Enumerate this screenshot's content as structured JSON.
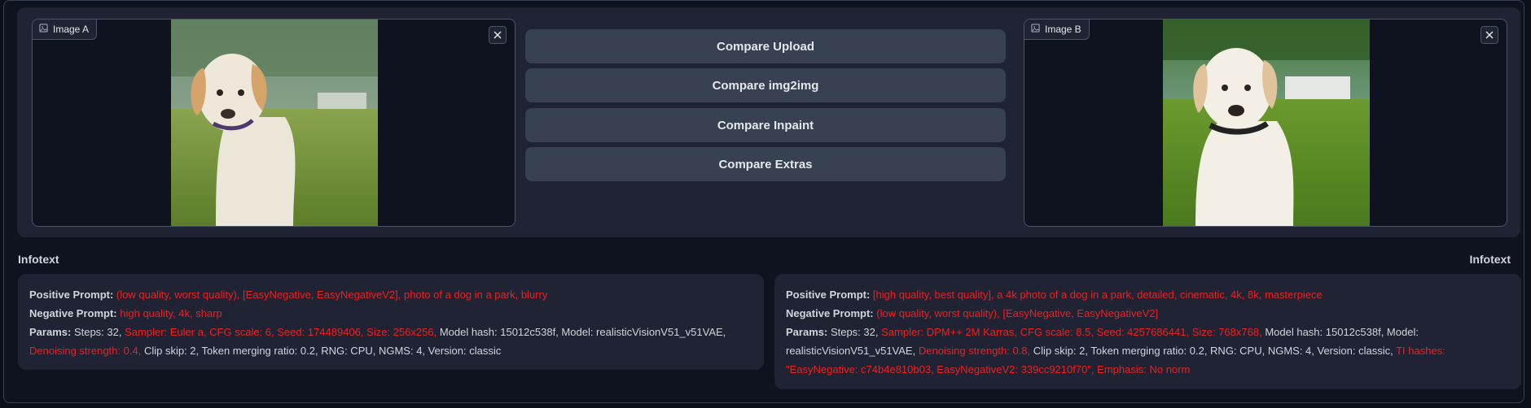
{
  "image_a": {
    "label": "Image A",
    "icon": "image-icon"
  },
  "image_b": {
    "label": "Image B",
    "icon": "image-icon"
  },
  "buttons": {
    "upload": "Compare Upload",
    "img2img": "Compare img2img",
    "inpaint": "Compare Inpaint",
    "extras": "Compare Extras"
  },
  "infotext_left": {
    "label": "Infotext",
    "positive_label": "Positive Prompt:",
    "positive": "(low quality, worst quality), [EasyNegative, EasyNegativeV2], photo of a dog in a park, blurry",
    "negative_label": "Negative Prompt:",
    "negative": "high quality, 4k, sharp",
    "params_label": "Params:",
    "steps": "Steps: 32,",
    "sampler": "Sampler: Euler a,",
    "cfg": "CFG scale: 6,",
    "seed": "Seed: 174489406,",
    "size": "Size: 256x256,",
    "model": "Model hash: 15012c538f, Model: realisticVisionV51_v51VAE,",
    "denoise": "Denoising strength: 0.4,",
    "rest": "Clip skip: 2, Token merging ratio: 0.2, RNG: CPU, NGMS: 4, Version: classic"
  },
  "infotext_right": {
    "label": "Infotext",
    "positive_label": "Positive Prompt:",
    "positive": "[high quality, best quality], a 4k photo of a dog in a park, detailed, cinematic, 4k, 8k, masterpiece",
    "negative_label": "Negative Prompt:",
    "negative": "(low quality, worst quality), [EasyNegative, EasyNegativeV2]",
    "params_label": "Params:",
    "steps": "Steps: 32,",
    "sampler": "Sampler: DPM++ 2M Karras,",
    "cfg": "CFG scale: 8.5,",
    "seed": "Seed: 4257686441,",
    "size": "Size: 768x768,",
    "model": "Model hash: 15012c538f, Model: realisticVisionV51_v51VAE,",
    "denoise": "Denoising strength: 0.8,",
    "mid": "Clip skip: 2, Token merging ratio: 0.2, RNG: CPU, NGMS: 4, Version: classic,",
    "ti": "TI hashes: \"EasyNegative: c74b4e810b03, EasyNegativeV2: 339cc9210f70\",",
    "emphasis": "Emphasis: No norm"
  }
}
